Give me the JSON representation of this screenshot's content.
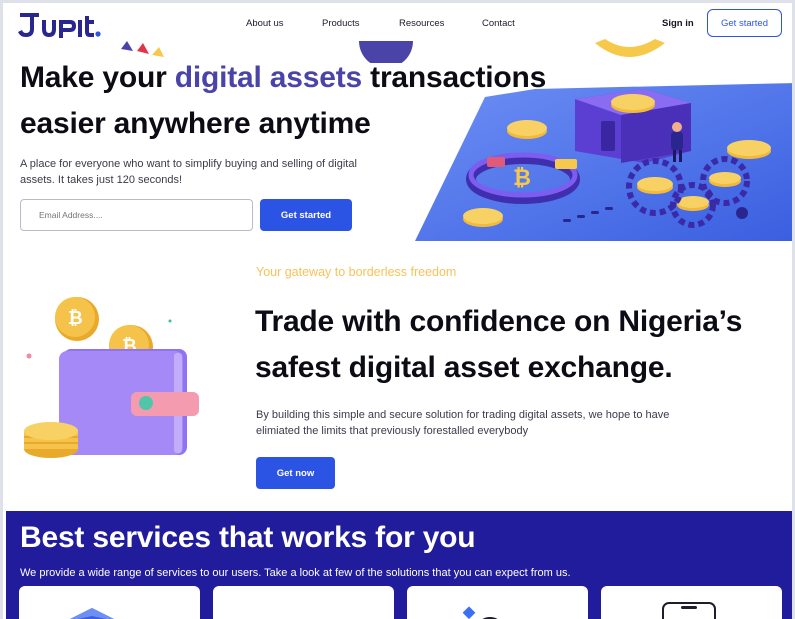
{
  "brand": {
    "logo_text": "Jupit.",
    "accent_color": "#2c54e4",
    "dark_accent": "#211c9c"
  },
  "nav": {
    "links": [
      "About us",
      "Products",
      "Resources",
      "Contact"
    ],
    "signin": "Sign in",
    "get_started": "Get started"
  },
  "hero": {
    "title_part1": "Make your ",
    "title_accent": "digital assets",
    "title_part2": " transactions easier anywhere anytime",
    "subtitle": "A place for everyone who want to simplify buying and selling of digital assets. It takes just 120 seconds!",
    "email_placeholder": "Email Address....",
    "cta": "Get started"
  },
  "trade": {
    "eyebrow": "Your gateway to borderless freedom",
    "title": "Trade with confidence on Nigeria’s safest digital asset exchange.",
    "description": "By building this simple and secure solution for trading digital assets, we hope to have elimiated the limits that previously forestalled everybody",
    "cta": "Get now"
  },
  "services": {
    "title": "Best services that works for you",
    "subtitle": "We provide a wide range of services to our users. Take a look at few of the solutions that you can expect from us.",
    "cards": [
      {
        "icon": "shield-card-icon"
      },
      {
        "icon": "device-card-icon"
      },
      {
        "icon": "exchange-card-icon"
      },
      {
        "icon": "phone-card-icon"
      }
    ]
  }
}
